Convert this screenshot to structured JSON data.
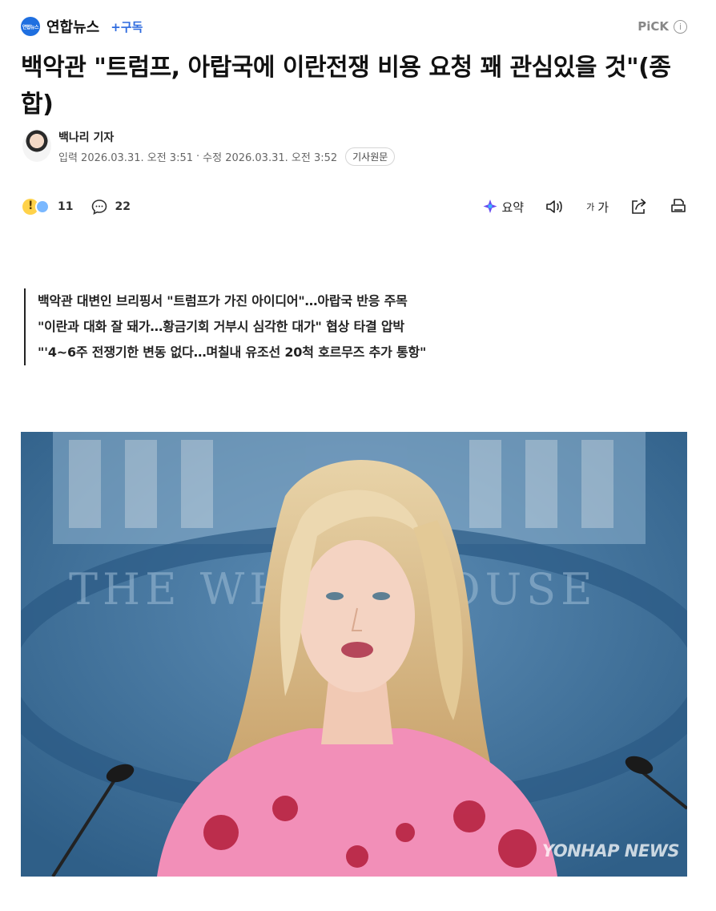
{
  "press": {
    "logo_text": "연합뉴스",
    "name": "연합뉴스",
    "subscribe_label": "+구독",
    "pick_label": "PiCK",
    "info_glyph": "i"
  },
  "article": {
    "title": "백악관 \"트럼프, 아랍국에 이란전쟁 비용 요청 꽤 관심있을 것\"(종합)",
    "reporter": "백나리 기자",
    "input_date": "입력 2026.03.31. 오전 3:51",
    "separator": "·",
    "edit_date": "수정 2026.03.31. 오전 3:52",
    "source_button": "기사원문"
  },
  "actions": {
    "reaction_count": "11",
    "comment_count": "22",
    "summary_label": "요약",
    "font_label_small": "가",
    "font_label_large": "가"
  },
  "summary": [
    "백악관 대변인 브리핑서 \"트럼프가 가진 아이디어\"…아랍국 반응 주목",
    "\"이란과 대화 잘 돼가…황금기회 거부시 심각한 대가\" 협상 타결 압박",
    "\"'4~6주 전쟁기한 변동 없다…며칠내 유조선 20척 호르무즈 추가 통항\""
  ],
  "photo": {
    "backdrop_text": "THE WHITE HOUSE",
    "watermark": "YONHAP NEWS"
  },
  "colors": {
    "accent": "#2f6bdf",
    "photo_backdrop": "#3f6d95"
  }
}
